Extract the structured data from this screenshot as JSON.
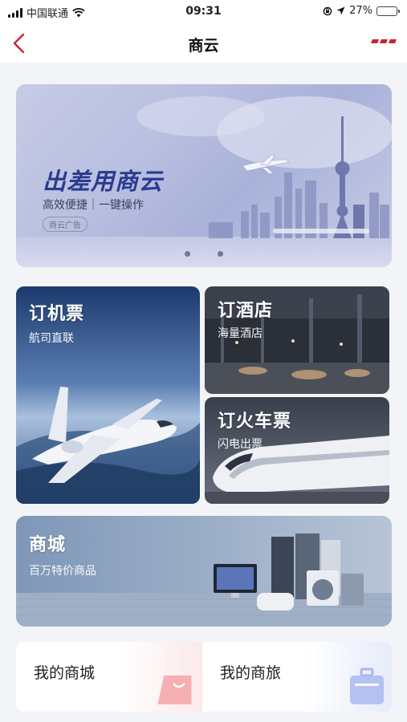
{
  "status": {
    "carrier": "中国联通",
    "time": "09:31",
    "battery": "27%",
    "battery_level": 0.27
  },
  "nav": {
    "title": "商云"
  },
  "banner": {
    "title": "出差用商云",
    "subtitle": "高效便捷｜一键操作",
    "ad_tag": "商云广告"
  },
  "tiles": {
    "flight": {
      "title": "订机票",
      "subtitle": "航司直联"
    },
    "hotel": {
      "title": "订酒店",
      "subtitle": "海量酒店"
    },
    "train": {
      "title": "订火车票",
      "subtitle": "闪电出票"
    },
    "mall": {
      "title": "商城",
      "subtitle": "百万特价商品"
    }
  },
  "cards": {
    "my_mall": "我的商城",
    "my_trip": "我的商旅"
  },
  "icons": {
    "signal": "signal-icon",
    "wifi": "wifi-icon",
    "location": "location-arrow-icon",
    "lock": "rotation-lock-icon",
    "battery": "battery-icon",
    "back": "back-arrow-icon",
    "more": "more-icon",
    "bag": "shopping-bag-icon",
    "suitcase": "suitcase-icon"
  },
  "colors": {
    "accent": "#c8262d",
    "banner_title": "#2a3b8f"
  }
}
